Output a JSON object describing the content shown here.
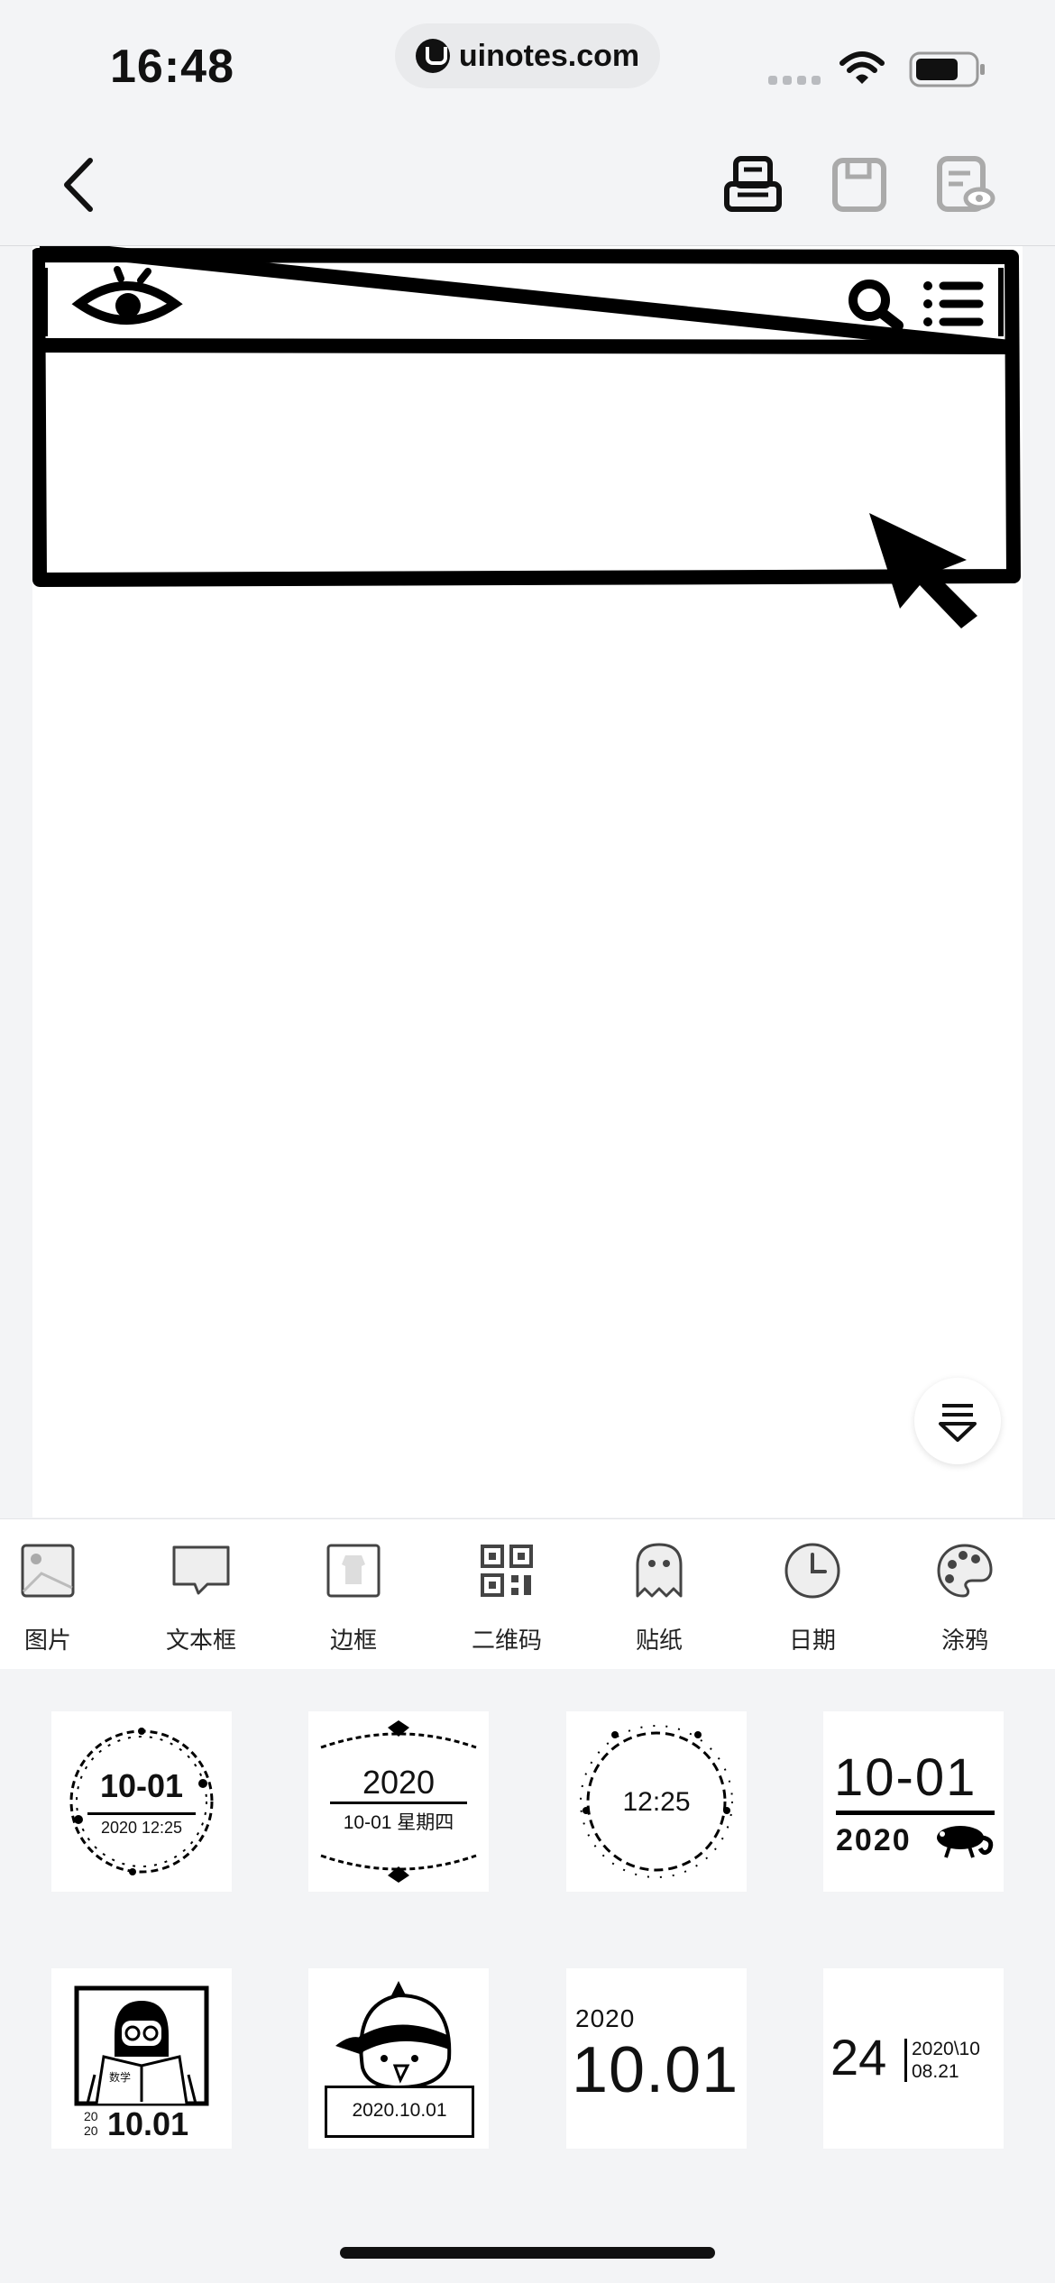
{
  "status": {
    "time": "16:48",
    "url": "uinotes.com"
  },
  "tools": [
    {
      "label": "图片",
      "icon": "image-icon"
    },
    {
      "label": "文本框",
      "icon": "textbox-icon"
    },
    {
      "label": "边框",
      "icon": "frame-icon"
    },
    {
      "label": "二维码",
      "icon": "qrcode-icon"
    },
    {
      "label": "贴纸",
      "icon": "sticker-icon"
    },
    {
      "label": "日期",
      "icon": "clock-icon"
    },
    {
      "label": "涂鸦",
      "icon": "palette-icon"
    }
  ],
  "stamps": {
    "s1": {
      "big": "10-01",
      "small": "2020 12:25"
    },
    "s2": {
      "top": "2020",
      "bottom": "10-01 星期四"
    },
    "s3": {
      "time": "12:25"
    },
    "s4": {
      "top": "10-01",
      "bottom": "2020"
    },
    "s5": {
      "yr1": "20",
      "yr2": "20",
      "date": "10.01",
      "book": "数学"
    },
    "s6": {
      "date": "2020.10.01"
    },
    "s7": {
      "year": "2020",
      "date": "10.01"
    },
    "s8": {
      "day": "24",
      "line1": "2020\\10",
      "line2": "08.21"
    }
  }
}
